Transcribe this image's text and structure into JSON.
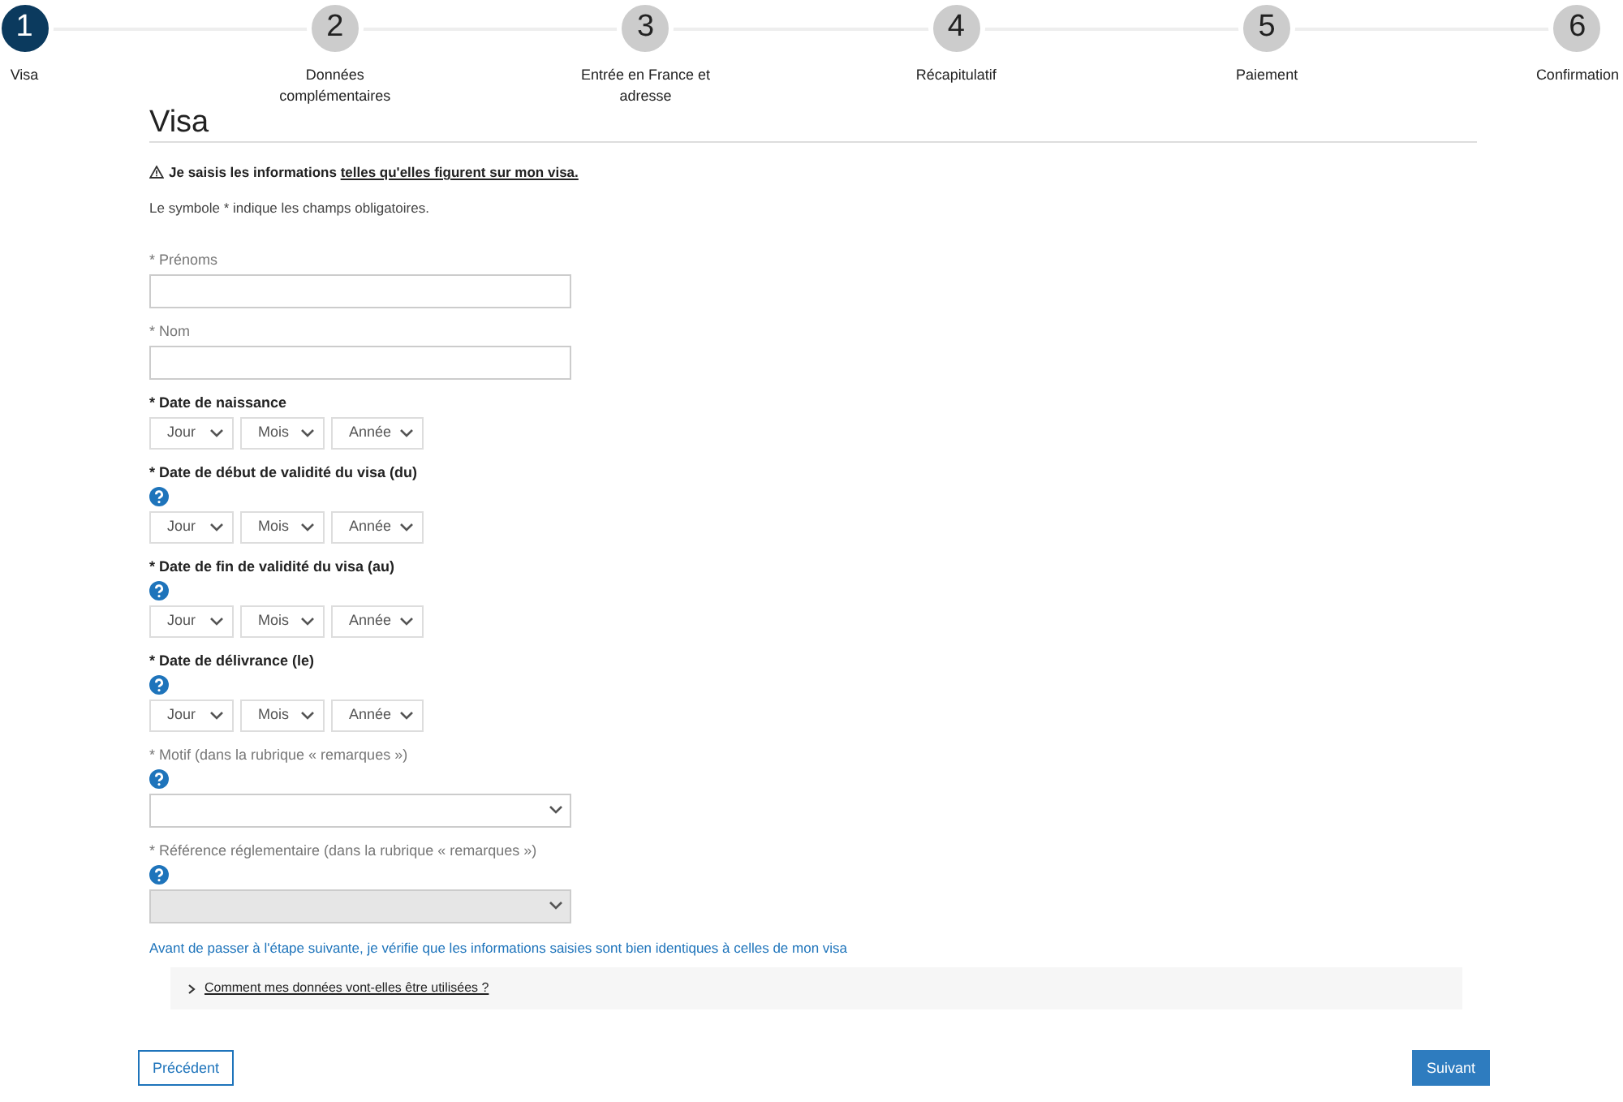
{
  "steps": [
    {
      "number": "1",
      "label": "Visa",
      "selected": true
    },
    {
      "number": "2",
      "label": "Données complémentaires",
      "selected": false
    },
    {
      "number": "3",
      "label": "Entrée en France et adresse",
      "selected": false
    },
    {
      "number": "4",
      "label": "Récapitulatif",
      "selected": false
    },
    {
      "number": "5",
      "label": "Paiement",
      "selected": false
    },
    {
      "number": "6",
      "label": "Confirmation",
      "selected": false
    }
  ],
  "heading": "Visa",
  "notice": {
    "text": "Je saisis les informations ",
    "link": "telles qu'elles figurent sur mon visa."
  },
  "required_note": "Le symbole * indique les champs obligatoires.",
  "fields": [
    {
      "kind": "text",
      "label": "* Prénoms",
      "help": false
    },
    {
      "kind": "text",
      "label": "* Nom",
      "help": false
    },
    {
      "kind": "date",
      "label": "* Date de naissance",
      "help": false,
      "parts": [
        "Jour",
        "Mois",
        "Année"
      ]
    },
    {
      "kind": "date",
      "label": "* Date de début de validité du visa (du)",
      "help": true,
      "parts": [
        "Jour",
        "Mois",
        "Année"
      ]
    },
    {
      "kind": "date",
      "label": "* Date de fin de validité du visa (au)",
      "help": true,
      "parts": [
        "Jour",
        "Mois",
        "Année"
      ]
    },
    {
      "kind": "date",
      "label": "* Date de délivrance (le)",
      "help": true,
      "parts": [
        "Jour",
        "Mois",
        "Année"
      ]
    },
    {
      "kind": "select",
      "label": "* Motif (dans la rubrique « remarques »)",
      "help": true,
      "disabled": false
    },
    {
      "kind": "select",
      "label": "* Référence réglementaire (dans la rubrique « remarques »)",
      "help": true,
      "disabled": true
    }
  ],
  "verify_note": "Avant de passer à l'étape suivante, je vérifie que les informations saisies sont bien identiques à celles de mon visa",
  "expander": {
    "label": "Comment mes données vont-elles être utilisées ?",
    "expanded": false
  },
  "buttons": {
    "previous": "Précédent",
    "next": "Suivant"
  }
}
